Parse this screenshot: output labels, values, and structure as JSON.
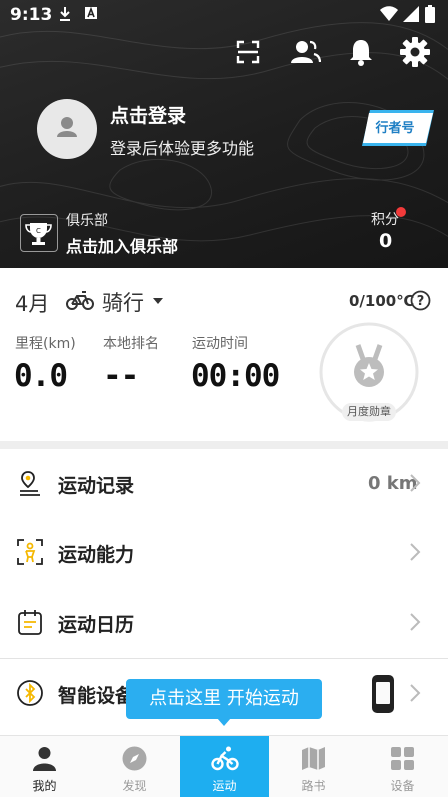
{
  "status_bar": {
    "time": "9:13"
  },
  "colors": {
    "accent": "#1eaef0",
    "badge": "#1f7fc4",
    "notification_dot": "#f23a3a",
    "header_bg": "#222222"
  },
  "toolbar": {
    "icons": [
      "scan-icon",
      "friends-icon",
      "bell-icon",
      "gear-icon"
    ]
  },
  "profile": {
    "title": "点击登录",
    "subtitle": "登录后体验更多功能",
    "badge_label": "行者号"
  },
  "club": {
    "label": "俱乐部",
    "join": "点击加入俱乐部"
  },
  "points": {
    "label": "积分",
    "value": "0"
  },
  "stats": {
    "month": "4月",
    "sport": "骑行",
    "temperature": "0/100℃",
    "items": [
      {
        "label": "里程(km)",
        "value": "0.0"
      },
      {
        "label": "本地排名",
        "value": "--"
      },
      {
        "label": "运动时间",
        "value": "00:00"
      }
    ],
    "medal_label": "月度勋章"
  },
  "menu": [
    {
      "label": "运动记录",
      "value": "0 km",
      "icon": "track-pin-icon"
    },
    {
      "label": "运动能力",
      "value": "",
      "icon": "ability-icon"
    },
    {
      "label": "运动日历",
      "value": "",
      "icon": "calendar-icon"
    },
    {
      "label": "智能设备",
      "value": "",
      "icon": "bluetooth-icon"
    }
  ],
  "tooltip": "点击这里 开始运动",
  "bottom_nav": [
    {
      "label": "我的",
      "icon": "person-icon"
    },
    {
      "label": "发现",
      "icon": "compass-icon"
    },
    {
      "label": "运动",
      "icon": "bike-icon"
    },
    {
      "label": "路书",
      "icon": "map-icon"
    },
    {
      "label": "设备",
      "icon": "devices-icon"
    }
  ]
}
